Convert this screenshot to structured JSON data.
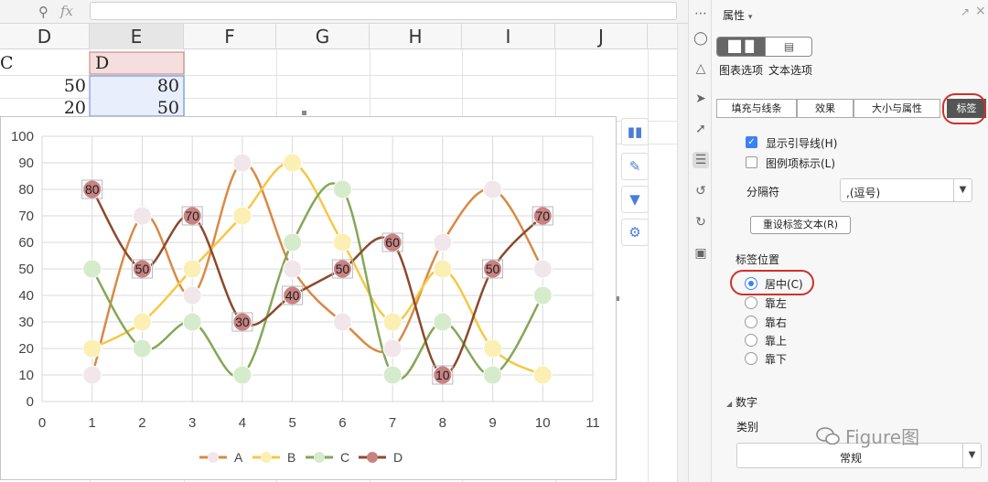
{
  "formula_bar": {
    "zoom_icon": "zoom-icon",
    "fx_label": "fx",
    "value": ""
  },
  "columns": [
    "D",
    "E",
    "F",
    "G",
    "H",
    "I",
    "J"
  ],
  "cells": {
    "c1": "C",
    "d1": "D",
    "c2": "50",
    "d2": "80",
    "c3": "20",
    "d3": "50"
  },
  "chart_data": {
    "type": "scatter",
    "style": "smooth lines with markers",
    "xlim": [
      0,
      11
    ],
    "ylim": [
      0,
      100
    ],
    "x_ticks": [
      "0",
      "1",
      "2",
      "3",
      "4",
      "5",
      "6",
      "7",
      "8",
      "9",
      "10",
      "11"
    ],
    "y_ticks": [
      "0",
      "10",
      "20",
      "30",
      "40",
      "50",
      "60",
      "70",
      "80",
      "90",
      "100"
    ],
    "grid": true,
    "legend_position": "bottom",
    "x": [
      1,
      2,
      3,
      4,
      5,
      6,
      7,
      8,
      9,
      10
    ],
    "series": [
      {
        "name": "A",
        "color": "#d88a45",
        "marker": "#f1e6ea",
        "values": [
          10,
          70,
          40,
          90,
          50,
          30,
          20,
          60,
          80,
          50
        ],
        "labels": false
      },
      {
        "name": "B",
        "color": "#f6c842",
        "marker": "#fbefb4",
        "values": [
          20,
          30,
          50,
          70,
          90,
          60,
          30,
          50,
          20,
          10
        ],
        "labels": false
      },
      {
        "name": "C",
        "color": "#83a857",
        "marker": "#d6ebcc",
        "values": [
          50,
          20,
          30,
          10,
          60,
          80,
          10,
          30,
          10,
          40
        ],
        "labels": false
      },
      {
        "name": "D",
        "color": "#8b4a2c",
        "marker": "#c98282",
        "values": [
          80,
          50,
          70,
          30,
          40,
          50,
          60,
          10,
          50,
          70
        ],
        "labels": true
      }
    ]
  },
  "chart_tools": [
    "chart-elements-icon",
    "chart-style-icon",
    "chart-filter-icon",
    "chart-settings-icon"
  ],
  "panel": {
    "title": "属性",
    "title_caret": "▾",
    "seg_chart_icon": "bar-chart-icon",
    "seg_text_icon": "text-box-icon",
    "chart_options": "图表选项",
    "text_options": "文本选项",
    "tabs": [
      "填充与线条",
      "效果",
      "大小与属性",
      "标签"
    ],
    "show_leader": "显示引导线(H)",
    "legend_key": "图例项标示(L)",
    "separator_label": "分隔符",
    "separator_value": ",(逗号)",
    "reset_button": "重设标签文本(R)",
    "label_position": "标签位置",
    "positions": [
      "居中(C)",
      "靠左",
      "靠右",
      "靠上",
      "靠下"
    ],
    "number_section": "数字",
    "number_caret": "◢",
    "category_label": "类别",
    "category_value": "常规",
    "watermark": "Figure图"
  }
}
